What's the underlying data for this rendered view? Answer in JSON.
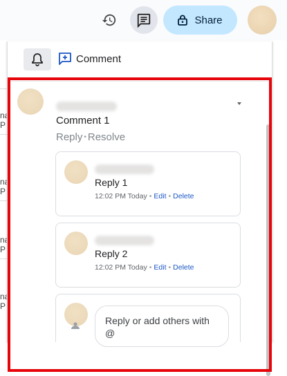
{
  "toolbar": {
    "history_icon": "history-icon",
    "comments_icon": "comments-icon",
    "share_label": "Share",
    "share_icon": "lock-icon"
  },
  "panel": {
    "header": {
      "bell_icon": "bell-icon",
      "comment_label": "Comment"
    },
    "thread": {
      "comment_text": "Comment 1",
      "reply_action": "Reply",
      "resolve_action": "Resolve",
      "replies": [
        {
          "text": "Reply 1",
          "time": "12:02 PM Today",
          "edit": "Edit",
          "delete": "Delete"
        },
        {
          "text": "Reply 2",
          "time": "12:02 PM Today",
          "edit": "Edit",
          "delete": "Delete"
        }
      ],
      "reply_placeholder": "Reply or add others with @"
    }
  },
  "doc_fragments": [
    "na",
    "P",
    "na",
    "P",
    "na",
    "P",
    "na",
    "P"
  ],
  "colors": {
    "share_bg": "#c2e7ff",
    "highlight": "#e5050a",
    "link": "#1a56c4"
  }
}
